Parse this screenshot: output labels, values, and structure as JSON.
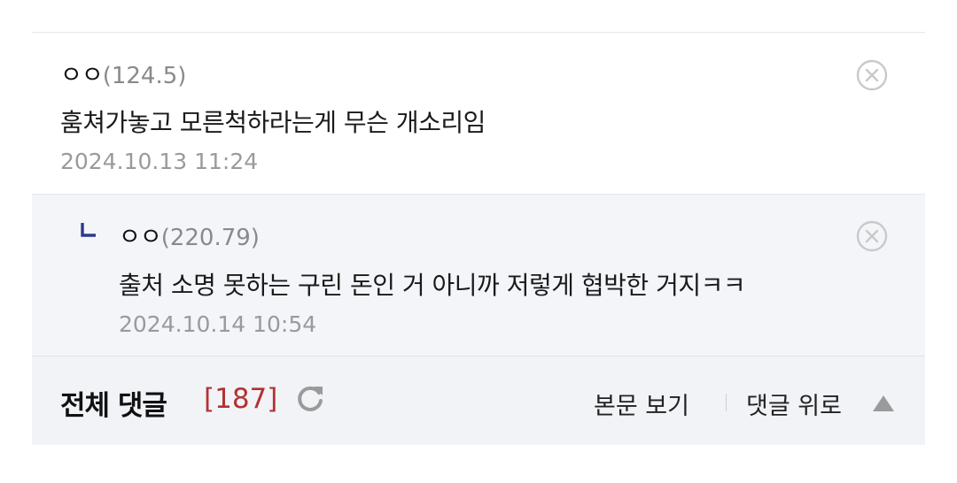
{
  "comment": {
    "nick": "ㅇㅇ",
    "ip": "(124.5)",
    "text": "훔쳐가놓고 모른척하라는게 무슨 개소리임",
    "date": "2024.10.13 11:24"
  },
  "reply": {
    "nick": "ㅇㅇ",
    "ip": "(220.79)",
    "text": "출처 소명 못하는 구린 돈인 거 아니까 저렇게 협박한 거지ㅋㅋ",
    "date": "2024.10.14 10:54"
  },
  "footer": {
    "title": "전체 댓글",
    "count": "[187]",
    "view_post": "본문 보기",
    "to_top": "댓글 위로"
  },
  "colors": {
    "count": "#b23232",
    "reply_bg": "#f4f5f9",
    "footer_bg": "#f2f3f7",
    "reply_mark": "#2b3a8c"
  },
  "icons": {
    "delete": "circle-x-icon",
    "reply": "reply-corner-icon",
    "refresh": "refresh-icon",
    "up": "triangle-up-icon"
  }
}
